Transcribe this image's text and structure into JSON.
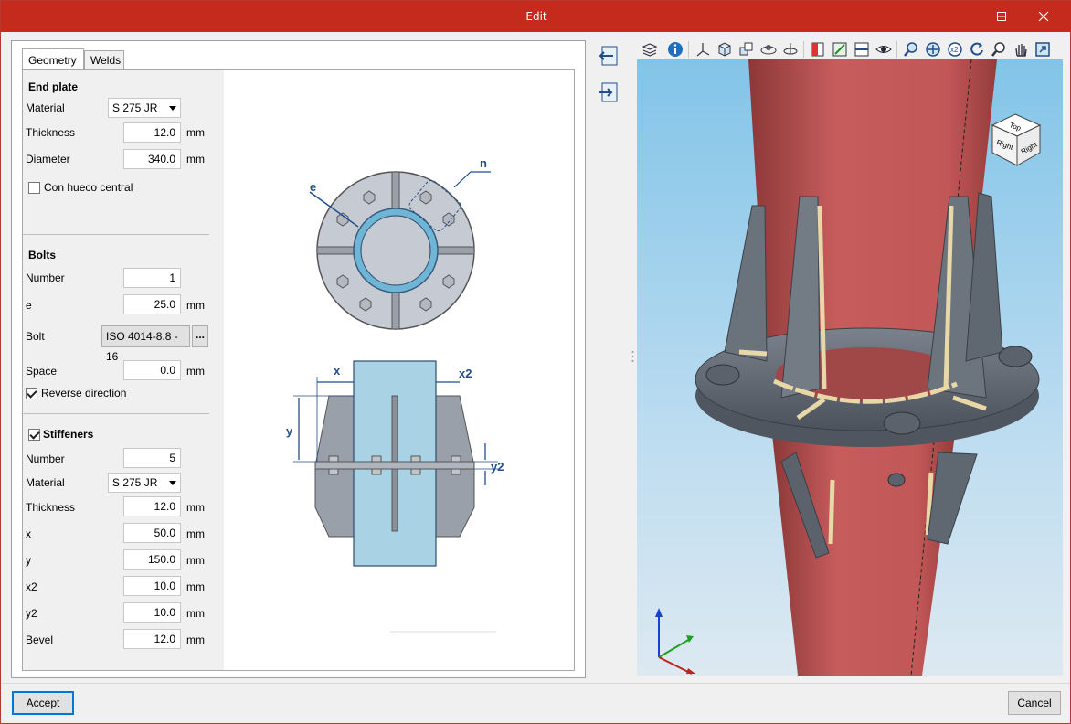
{
  "window": {
    "title": "Edit"
  },
  "tabs": [
    {
      "label": "Geometry"
    },
    {
      "label": "Welds"
    }
  ],
  "end_plate": {
    "title": "End plate",
    "material_label": "Material",
    "material_value": "S 275 JR",
    "thickness_label": "Thickness",
    "thickness_value": "12.0",
    "thickness_unit": "mm",
    "diameter_label": "Diameter",
    "diameter_value": "340.0",
    "diameter_unit": "mm",
    "hole_label": "Con hueco central",
    "hole_checked": false
  },
  "bolts": {
    "title": "Bolts",
    "number_label": "Number",
    "number_value": "1",
    "e_label": "e",
    "e_value": "25.0",
    "e_unit": "mm",
    "bolt_label": "Bolt",
    "bolt_value": "ISO 4014-8.8 - 16",
    "bolt_more": "...",
    "space_label": "Space",
    "space_value": "0.0",
    "space_unit": "mm",
    "reverse_label": "Reverse direction",
    "reverse_checked": true
  },
  "stiffeners": {
    "title": "Stiffeners",
    "checked": true,
    "number_label": "Number",
    "number_value": "5",
    "material_label": "Material",
    "material_value": "S 275 JR",
    "thickness_label": "Thickness",
    "thickness_value": "12.0",
    "thickness_unit": "mm",
    "x_label": "x",
    "x_value": "50.0",
    "x_unit": "mm",
    "y_label": "y",
    "y_value": "150.0",
    "y_unit": "mm",
    "x2_label": "x2",
    "x2_value": "10.0",
    "x2_unit": "mm",
    "y2_label": "y2",
    "y2_value": "10.0",
    "y2_unit": "mm",
    "bevel_label": "Bevel",
    "bevel_value": "12.0",
    "bevel_unit": "mm"
  },
  "drawing_labels": {
    "e": "e",
    "n": "n",
    "x": "x",
    "x2": "x2",
    "y": "y",
    "y2": "y2"
  },
  "viewcube": {
    "top": "Top",
    "front": "Right",
    "side": "Right"
  },
  "buttons": {
    "accept": "Accept",
    "cancel": "Cancel"
  },
  "icons": {
    "mid": [
      "import-left-icon",
      "export-right-icon"
    ],
    "toolbar": [
      "layers-icon",
      "info-icon",
      "axes-icon",
      "cube-view-icon",
      "multi-cube-icon",
      "orbit-icon",
      "rotate-icon",
      "section-icon",
      "grid-icon",
      "plane-icon",
      "eye-icon",
      "zoom-window-icon",
      "zoom-all-icon",
      "zoom-x2-icon",
      "refresh-zoom-icon",
      "zoom-icon",
      "pan-hand-icon",
      "fit-view-icon"
    ]
  },
  "colors": {
    "titlebar": "#c42b1c",
    "column": "#c85a5a",
    "plate": "#5d6570",
    "weld": "#e8d8a8",
    "diagram_blue": "#1f4e8c"
  }
}
